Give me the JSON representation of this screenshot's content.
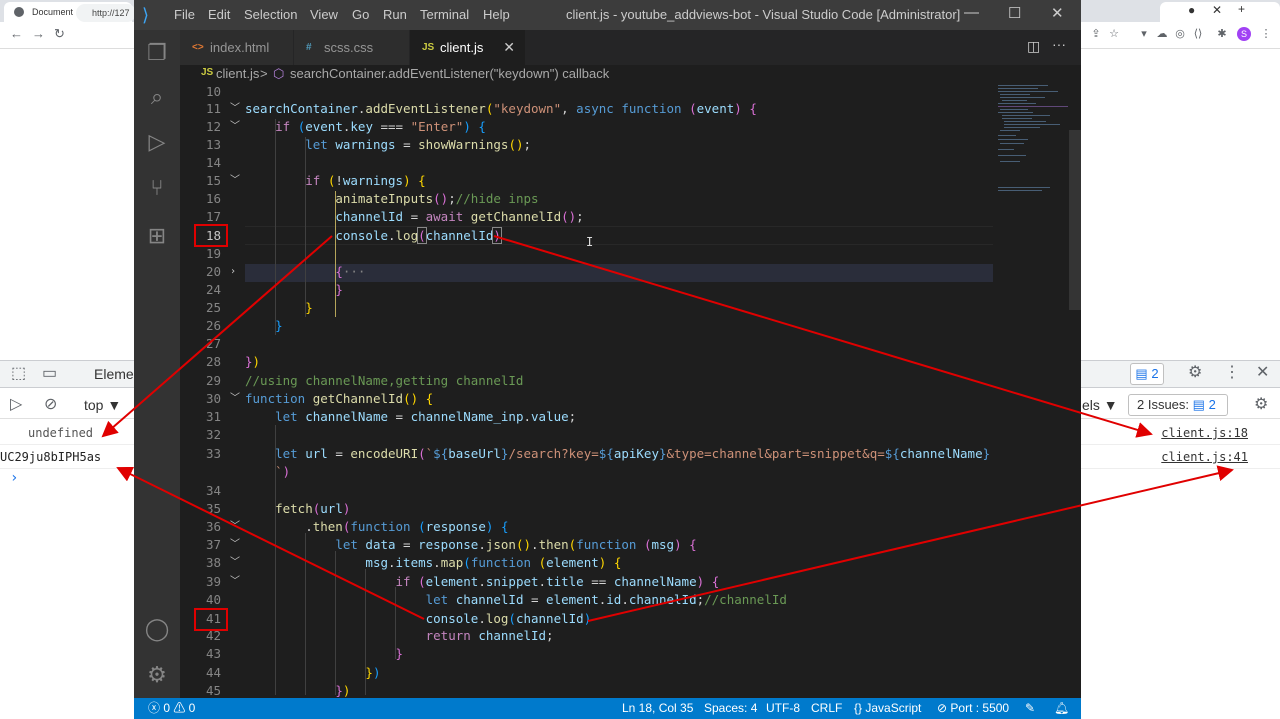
{
  "browser": {
    "tab_title": "Document",
    "url": "http://127",
    "profile_initial": "S"
  },
  "devtools": {
    "elements_tab": "Eleme",
    "context": "top",
    "issues_badge_count": "2",
    "levels_label": "els",
    "issues_label": "2 Issues:",
    "issues_count": "2",
    "logs": [
      {
        "text": "undefined",
        "source": "client.js:18"
      },
      {
        "text": "UC29ju8bIPH5as",
        "source": "client.js:41"
      }
    ],
    "prompt": "›"
  },
  "vscode": {
    "menu": [
      "File",
      "Edit",
      "Selection",
      "View",
      "Go",
      "Run",
      "Terminal",
      "Help"
    ],
    "window_title": "client.js - youtube_addviews-bot - Visual Studio Code [Administrator]",
    "tabs": [
      {
        "icon": "<>",
        "label": "index.html",
        "active": false
      },
      {
        "icon": "#",
        "label": "scss.css",
        "active": false
      },
      {
        "icon": "JS",
        "label": "client.js",
        "active": true
      }
    ],
    "breadcrumb": {
      "js_badge": "JS",
      "file": "client.js",
      "separator": ">",
      "symbol": "searchContainer.addEventListener(\"keydown\") callback"
    },
    "line_numbers": [
      "10",
      "11",
      "12",
      "13",
      "14",
      "15",
      "16",
      "17",
      "18",
      "19",
      "20",
      "24",
      "25",
      "26",
      "27",
      "28",
      "29",
      "30",
      "31",
      "32",
      "33",
      "",
      "34",
      "35",
      "36",
      "37",
      "38",
      "39",
      "40",
      "41",
      "42",
      "43",
      "44",
      "45"
    ],
    "status": {
      "problems": "ⓧ 0 ⚠ 0",
      "position": "Ln 18, Col 35",
      "spaces": "Spaces: 4",
      "encoding": "UTF-8",
      "eol": "CRLF",
      "language": "{} JavaScript",
      "port": "⊘ Port : 5500"
    },
    "colors": {
      "statusbar": "#007acc",
      "editor_bg": "#1e1e1e",
      "annotation": "#e00000"
    }
  }
}
